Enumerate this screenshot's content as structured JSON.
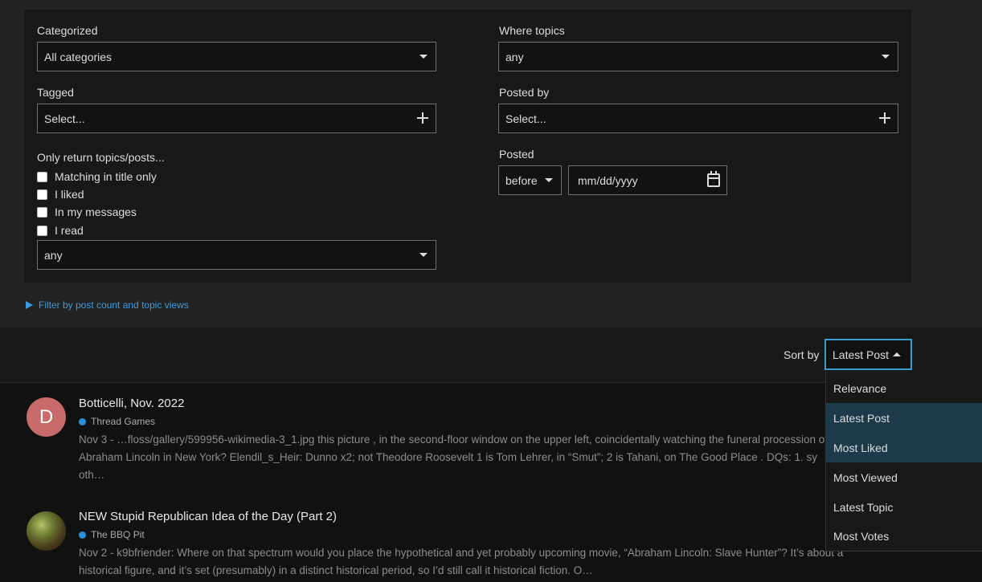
{
  "filters": {
    "categorized": {
      "label": "Categorized",
      "value": "All categories"
    },
    "tagged": {
      "label": "Tagged",
      "placeholder": "Select..."
    },
    "only_return": {
      "label": "Only return topics/posts...",
      "options": [
        "Matching in title only",
        "I liked",
        "In my messages",
        "I read"
      ],
      "select_value": "any"
    },
    "where_topics": {
      "label": "Where topics",
      "value": "any"
    },
    "posted_by": {
      "label": "Posted by",
      "placeholder": "Select..."
    },
    "posted": {
      "label": "Posted",
      "when": "before",
      "date_placeholder": "mm/dd/yyyy"
    }
  },
  "advanced_toggle": "Filter by post count and topic views",
  "sort": {
    "label": "Sort by",
    "value": "Latest Post",
    "options": [
      "Relevance",
      "Latest Post",
      "Most Liked",
      "Most Viewed",
      "Latest Topic",
      "Most Votes"
    ]
  },
  "results": [
    {
      "avatar_letter": "D",
      "title": "Botticelli, Nov. 2022",
      "category": "Thread Games",
      "blurb_lines": [
        "Nov 3 - …floss/gallery/599956-wikimedia-3_1.jpg this picture , in the second-floor window on the upper left, coincidentally watching the funeral procession of",
        "Abraham Lincoln in New York? Elendil_s_Heir: Dunno x2; not Theodore Roosevelt 1 is Tom Lehrer, in “Smut”; 2 is Tahani, on The Good Place . DQs: 1. sy",
        "oth…"
      ]
    },
    {
      "avatar_letter": "",
      "title": "NEW Stupid Republican Idea of the Day (Part 2)",
      "category": "The BBQ Pit",
      "blurb_lines": [
        "Nov 2 - k9bfriender: Where on that spectrum would you place the hypothetical and yet probably upcoming movie, “Abraham Lincoln: Slave Hunter”? It’s about a",
        "historical figure, and it’s set (presumably) in a distinct historical period, so I’d still call it historical fiction. O…"
      ]
    }
  ],
  "colors": {
    "accent": "#3a9ccf",
    "link": "#3a9de0",
    "category_dot": "#2f8fd8",
    "highlight": "#1c3a4a"
  }
}
